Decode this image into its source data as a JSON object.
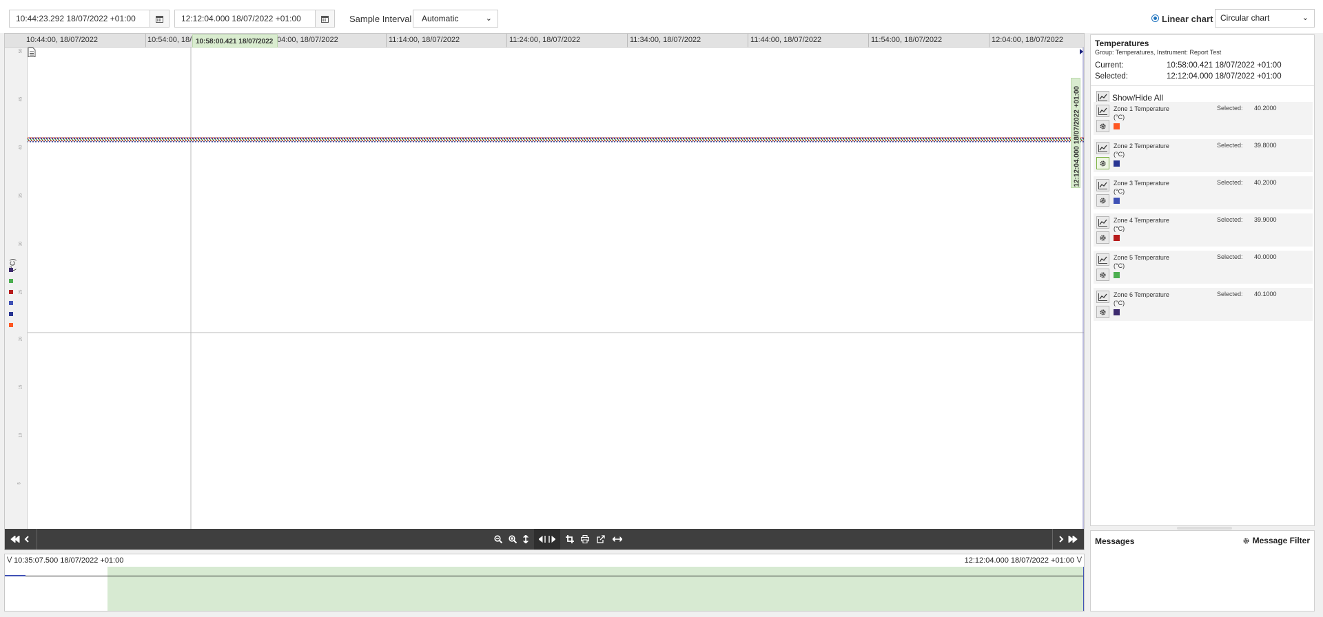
{
  "toolbar": {
    "start_datetime": "10:44:23.292 18/07/2022 +01:00",
    "end_datetime": "12:12:04.000 18/07/2022 +01:00",
    "sample_interval_label": "Sample Interval",
    "sample_interval_value": "Automatic",
    "linear_chart_label": "Linear chart",
    "chart_type_value": "Circular chart"
  },
  "chart": {
    "time_ticks": [
      "10:44:00, 18/07/2022",
      "10:54:00, 18/0",
      "04:00, 18/07/2022",
      "11:14:00, 18/07/2022",
      "11:24:00, 18/07/2022",
      "11:34:00, 18/07/2022",
      "11:44:00, 18/07/2022",
      "11:54:00, 18/07/2022",
      "12:04:00, 18/07/2022"
    ],
    "current_cursor_label": "10:58:00.421 18/07/2022",
    "selected_cursor_label": "12:12:04.000 18/07/2022 +01:00",
    "y_unit": "(°C)",
    "y_ticks": [
      "50",
      "45",
      "40",
      "35",
      "30",
      "25",
      "20",
      "15",
      "10",
      "5"
    ],
    "y_swatch_colors": [
      "#3d2b6e",
      "#4caf50",
      "#b71c1c",
      "#3f51b5",
      "#283593",
      "#ff5722"
    ]
  },
  "chart_data": {
    "type": "line",
    "xlabel": "",
    "ylabel": "(°C)",
    "ylim": [
      0,
      50
    ],
    "x": [
      "10:44:23",
      "12:12:04"
    ],
    "series": [
      {
        "name": "Zone 1 Temperature (°C)",
        "values": [
          40.2,
          40.2
        ],
        "color": "#ff5722"
      },
      {
        "name": "Zone 2 Temperature (°C)",
        "values": [
          39.8,
          39.8
        ],
        "color": "#283593"
      },
      {
        "name": "Zone 3 Temperature (°C)",
        "values": [
          40.2,
          40.2
        ],
        "color": "#3f51b5"
      },
      {
        "name": "Zone 4 Temperature (°C)",
        "values": [
          39.9,
          39.9
        ],
        "color": "#b71c1c"
      },
      {
        "name": "Zone 5 Temperature (°C)",
        "values": [
          40.0,
          40.0
        ],
        "color": "#4caf50"
      },
      {
        "name": "Zone 6 Temperature (°C)",
        "values": [
          40.1,
          40.1
        ],
        "color": "#3d2b6e"
      }
    ],
    "grid": true
  },
  "overview": {
    "start_label": "10:35:07.500 18/07/2022 +01:00",
    "end_label": "12:12:04.000 18/07/2022 +01:00"
  },
  "temperatures": {
    "title": "Temperatures",
    "subtitle": "Group: Temperatures, Instrument: Report Test",
    "current_label": "Current:",
    "current_value": "10:58:00.421 18/07/2022 +01:00",
    "selected_label": "Selected:",
    "selected_value": "12:12:04.000 18/07/2022 +01:00",
    "show_hide_all": "Show/Hide All",
    "selected_word": "Selected:",
    "zones": [
      {
        "name": "Zone 1 Temperature (°C)",
        "value": "40.2000",
        "color": "#ff5722"
      },
      {
        "name": "Zone 2 Temperature (°C)",
        "value": "39.8000",
        "color": "#283593"
      },
      {
        "name": "Zone 3 Temperature (°C)",
        "value": "40.2000",
        "color": "#3f51b5"
      },
      {
        "name": "Zone 4 Temperature (°C)",
        "value": "39.9000",
        "color": "#b71c1c"
      },
      {
        "name": "Zone 5 Temperature (°C)",
        "value": "40.0000",
        "color": "#4caf50"
      },
      {
        "name": "Zone 6 Temperature (°C)",
        "value": "40.1000",
        "color": "#3d2b6e"
      }
    ]
  },
  "messages": {
    "title": "Messages",
    "filter_label": "Message Filter"
  }
}
